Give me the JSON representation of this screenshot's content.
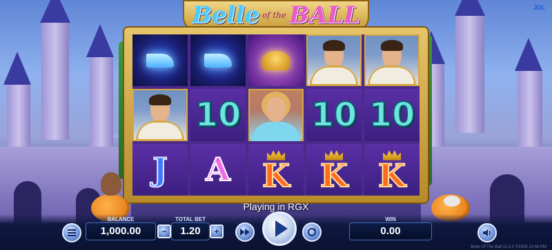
{
  "game": {
    "title_part1": "Belle",
    "title_part2": "of the",
    "title_part3": "BALL",
    "brand": "JDL",
    "status": "Playing in RGX",
    "footer": "Belle Of The Ball v1.0.0 ©2024 10:48 PM"
  },
  "reels": [
    [
      {
        "symbol": "glass-slipper",
        "label": ""
      },
      {
        "symbol": "prince",
        "label": ""
      },
      {
        "symbol": "jack",
        "label": "J"
      }
    ],
    [
      {
        "symbol": "glass-slipper",
        "label": ""
      },
      {
        "symbol": "ten",
        "label": "10"
      },
      {
        "symbol": "ace",
        "label": "A"
      }
    ],
    [
      {
        "symbol": "golden-carriage",
        "label": ""
      },
      {
        "symbol": "princess",
        "label": ""
      },
      {
        "symbol": "king",
        "label": "K"
      }
    ],
    [
      {
        "symbol": "prince",
        "label": ""
      },
      {
        "symbol": "ten",
        "label": "10"
      },
      {
        "symbol": "king",
        "label": "K"
      }
    ],
    [
      {
        "symbol": "prince",
        "label": ""
      },
      {
        "symbol": "ten",
        "label": "10"
      },
      {
        "symbol": "king",
        "label": "K"
      }
    ]
  ],
  "hud": {
    "balance_label": "BALANCE",
    "balance_value": "1,000.00",
    "total_bet_label": "TOTAL BET",
    "total_bet_value": "1.20",
    "minus_symbol": "−",
    "plus_symbol": "+",
    "win_label": "WIN",
    "win_value": "0.00",
    "menu_icon": "menu-icon",
    "turbo_icon": "fast-forward-icon",
    "spin_icon": "play-icon",
    "autoplay_icon": "autoplay-icon",
    "sound_icon": "speaker-icon"
  },
  "colors": {
    "accent": "#e7c46a",
    "ten_symbol": "#6fe3e0",
    "ace_symbol": "#ee6ce8",
    "king_symbol": "#ff6a1f",
    "jack_symbol": "#3a7bff"
  }
}
